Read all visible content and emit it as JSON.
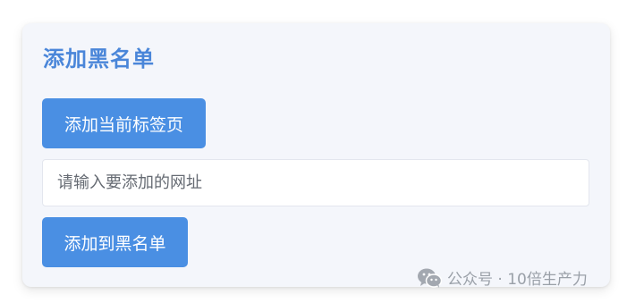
{
  "panel": {
    "title": "添加黑名单",
    "add_current_tab_label": "添加当前标签页",
    "url_input": {
      "value": "",
      "placeholder": "请输入要添加的网址"
    },
    "add_to_blacklist_label": "添加到黑名单"
  },
  "watermark": {
    "icon": "wechat-icon",
    "text": "公众号 · 10倍生产力"
  },
  "colors": {
    "accent": "#4a8fe3",
    "title": "#4a86d9",
    "card_background": "#f4f6fb"
  }
}
